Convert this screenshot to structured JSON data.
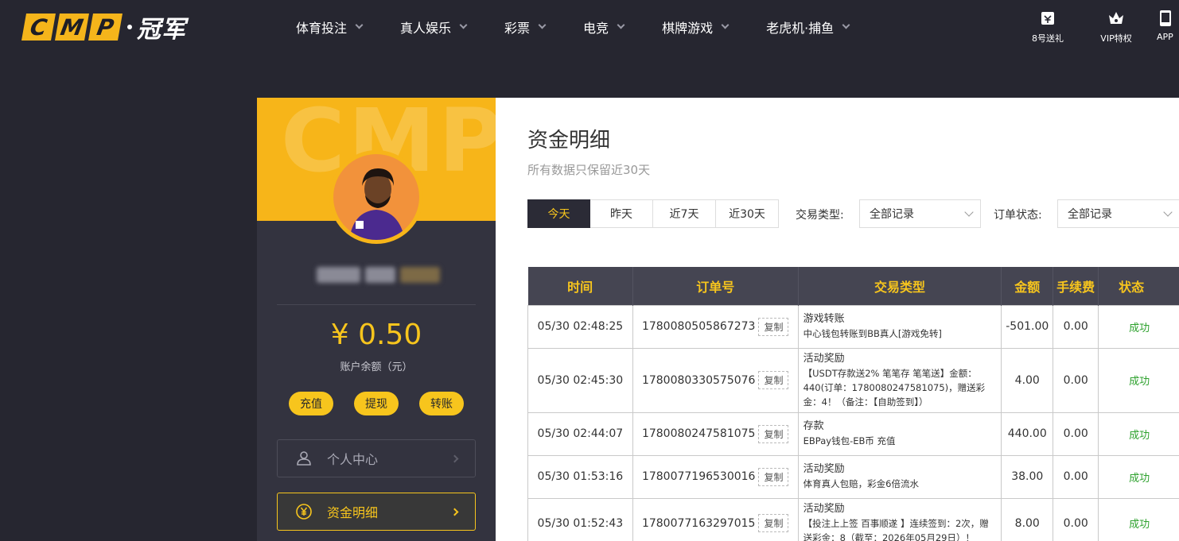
{
  "header": {
    "logo_letters": [
      "C",
      "M",
      "P"
    ],
    "logo_cn": "冠军",
    "nav": [
      {
        "label": "体育投注"
      },
      {
        "label": "真人娱乐"
      },
      {
        "label": "彩票"
      },
      {
        "label": "电竞"
      },
      {
        "label": "棋牌游戏"
      },
      {
        "label": "老虎机·捕鱼"
      }
    ],
    "right": [
      {
        "label": "8号送礼",
        "icon": "gift-ticket-icon"
      },
      {
        "label": "VIP特权",
        "icon": "crown-icon"
      },
      {
        "label": "APP",
        "icon": "phone-icon"
      }
    ]
  },
  "profile": {
    "banner_text": "CMP",
    "balance": "¥ 0.50",
    "balance_label": "账户余额（元）",
    "actions": [
      "充值",
      "提现",
      "转账"
    ],
    "menu": [
      {
        "label": "个人中心",
        "icon": "user-icon",
        "active": false
      },
      {
        "label": "资金明细",
        "icon": "yen-circle-icon",
        "active": true
      }
    ]
  },
  "main": {
    "title": "资金明细",
    "subtitle": "所有数据只保留近30天",
    "date_tabs": [
      {
        "label": "今天",
        "active": true
      },
      {
        "label": "昨天",
        "active": false
      },
      {
        "label": "近7天",
        "active": false
      },
      {
        "label": "近30天",
        "active": false
      }
    ],
    "filters": {
      "type_label": "交易类型:",
      "type_value": "全部记录",
      "status_label": "订单状态:",
      "status_value": "全部记录"
    },
    "table": {
      "columns": [
        "时间",
        "订单号",
        "交易类型",
        "金额",
        "手续费",
        "状态"
      ],
      "copy_label": "复制",
      "rows": [
        {
          "time": "05/30 02:48:25",
          "order": "1780080505867273",
          "type": "游戏转账",
          "detail": "中心钱包转账到BB真人[游戏免转]",
          "amount": "-501.00",
          "fee": "0.00",
          "status": "成功"
        },
        {
          "time": "05/30 02:45:30",
          "order": "1780080330575076",
          "type": "活动奖励",
          "detail": "【USDT存款送2% 笔笔存 笔笔送】金额：440(订单：1780080247581075)，赠送彩金：4！（备注：【自助签到】）",
          "amount": "4.00",
          "fee": "0.00",
          "status": "成功"
        },
        {
          "time": "05/30 02:44:07",
          "order": "1780080247581075",
          "type": "存款",
          "detail": "EBPay钱包-EB币 充值",
          "amount": "440.00",
          "fee": "0.00",
          "status": "成功"
        },
        {
          "time": "05/30 01:53:16",
          "order": "1780077196530016",
          "type": "活动奖励",
          "detail": "体育真人包赔，彩金6倍流水",
          "amount": "38.00",
          "fee": "0.00",
          "status": "成功"
        },
        {
          "time": "05/30 01:52:43",
          "order": "1780077163297015",
          "type": "活动奖励",
          "detail": "【投注上上签 百事顺遂 】连续签到：2次，赠送彩金：8（截至：2026年05月29日）！",
          "amount": "8.00",
          "fee": "0.00",
          "status": "成功"
        }
      ]
    }
  },
  "colors": {
    "accent": "#f7c51d",
    "dark": "#262630",
    "success": "#2da12d"
  }
}
